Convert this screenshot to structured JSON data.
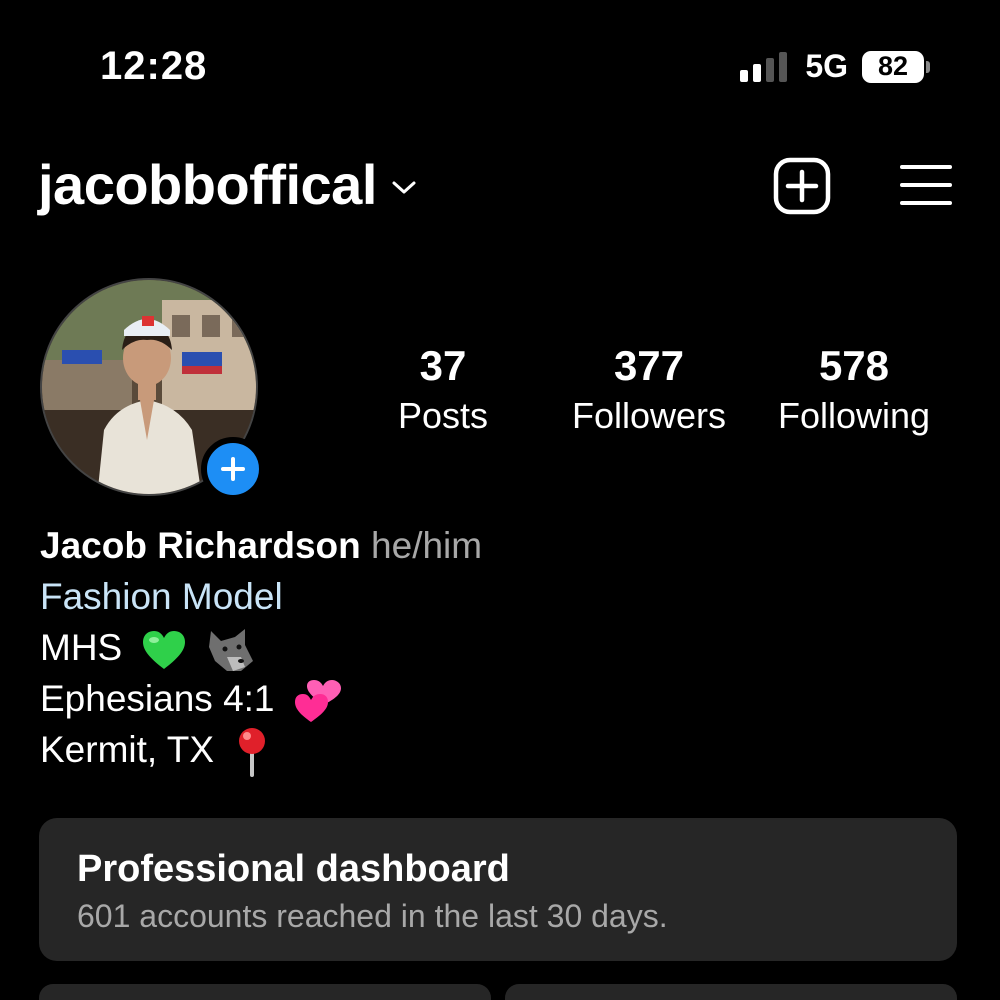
{
  "status_bar": {
    "time": "12:28",
    "network": "5G",
    "battery": "82"
  },
  "header": {
    "username": "jacobboffical",
    "icons": [
      "chevron-down-icon",
      "new-post-icon",
      "menu-icon"
    ]
  },
  "profile": {
    "stats": [
      {
        "value": "37",
        "label": "Posts"
      },
      {
        "value": "377",
        "label": "Followers"
      },
      {
        "value": "578",
        "label": "Following"
      }
    ]
  },
  "bio": {
    "name": "Jacob Richardson",
    "pronouns": "he/him",
    "category": "Fashion Model",
    "line1": "MHS",
    "line2": "Ephesians 4:1",
    "line3": "Kermit, TX"
  },
  "dashboard": {
    "title": "Professional dashboard",
    "subtitle": "601 accounts reached in the last 30 days."
  },
  "colors": {
    "background": "#000000",
    "card": "#262626",
    "accent_blue": "#1d8ef5",
    "category_text": "#c9e4f7",
    "muted_text": "#a8a8a8"
  }
}
